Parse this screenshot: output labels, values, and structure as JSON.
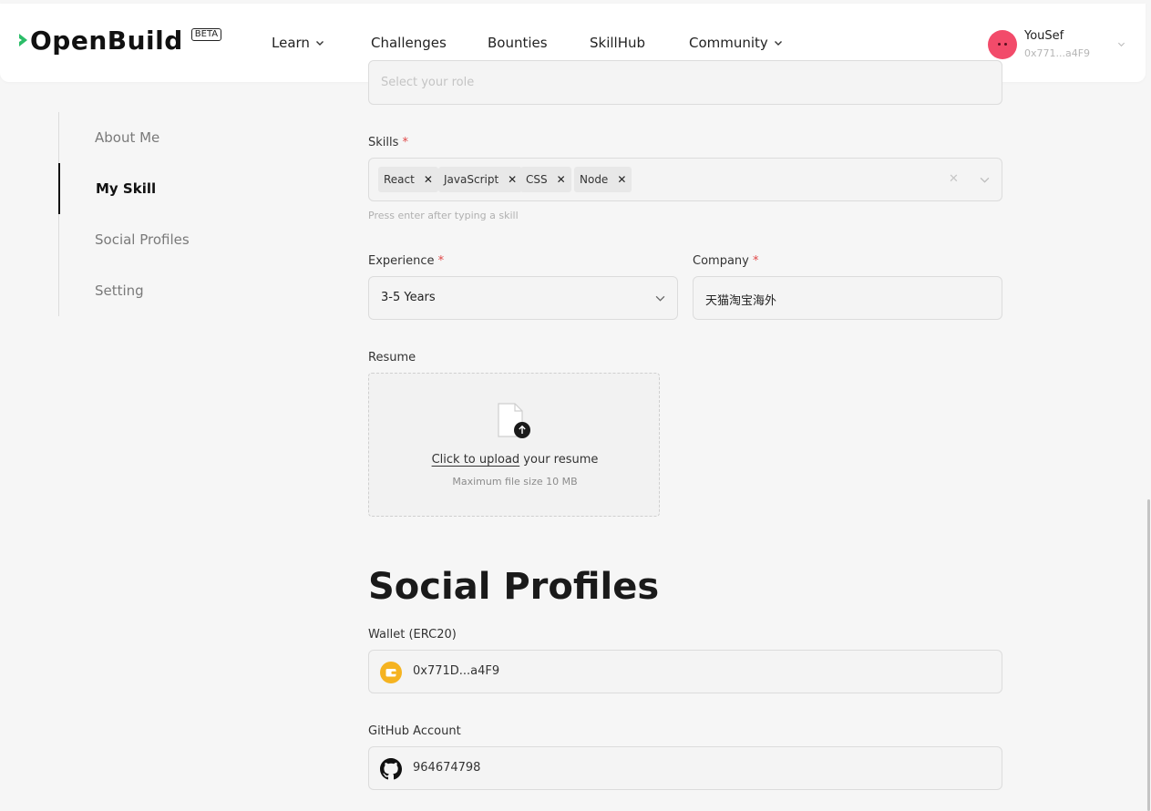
{
  "header": {
    "logo_text": "OpenBuild",
    "beta_label": "BETA",
    "nav": [
      {
        "label": "Learn",
        "has_dropdown": true
      },
      {
        "label": "Challenges",
        "has_dropdown": false
      },
      {
        "label": "Bounties",
        "has_dropdown": false
      },
      {
        "label": "SkillHub",
        "has_dropdown": false
      },
      {
        "label": "Community",
        "has_dropdown": true
      }
    ],
    "user": {
      "name": "YouSef",
      "address": "0x771...a4F9"
    }
  },
  "sidebar": {
    "items": [
      {
        "label": "About Me",
        "active": false
      },
      {
        "label": "My Skill",
        "active": true
      },
      {
        "label": "Social Profiles",
        "active": false
      },
      {
        "label": "Setting",
        "active": false
      }
    ]
  },
  "form": {
    "role": {
      "placeholder": "Select your role"
    },
    "skills": {
      "label": "Skills",
      "required_mark": "*",
      "tags": [
        "React",
        "JavaScript",
        "CSS",
        "Node"
      ],
      "hint": "Press enter after typing a skill"
    },
    "experience": {
      "label": "Experience",
      "required_mark": "*",
      "value": "3-5 Years"
    },
    "company": {
      "label": "Company",
      "required_mark": "*",
      "value": "天猫淘宝海外"
    },
    "resume": {
      "label": "Resume",
      "upload_link": "Click to upload",
      "upload_text": " your resume",
      "max_size": "Maximum file size 10 MB"
    }
  },
  "social": {
    "title": "Social Profiles",
    "wallet": {
      "label": "Wallet (ERC20)",
      "value": "0x771D...a4F9",
      "icon": "wallet-icon"
    },
    "github": {
      "label": "GitHub Account",
      "value": "964674798",
      "icon": "github-icon"
    }
  },
  "colors": {
    "accent": "#1a1a1a",
    "required": "#e04848",
    "logo_green": "#2bbd68",
    "avatar": "#f24b6a",
    "wallet_icon": "#f5b320"
  }
}
